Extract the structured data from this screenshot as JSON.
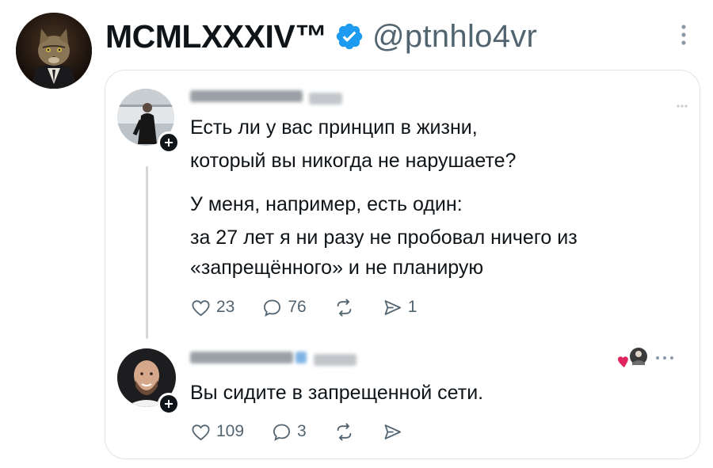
{
  "post": {
    "author_name": "MCMLXXXIV™",
    "handle": "@ptnhlo4vr"
  },
  "quoted_thread": {
    "first_post": {
      "line1": "Есть ли у вас принцип в жизни,",
      "line2": "который вы никогда не нарушаете?",
      "line3": "У меня, например, есть один:",
      "line4": "за 27 лет я ни разу не пробовал ничего из",
      "line5": "«запрещённого» и не планирую",
      "likes": "23",
      "replies": "76",
      "shares": "1"
    },
    "reply_post": {
      "text": "Вы сидите в запрещенной сети.",
      "likes": "109",
      "replies": "3"
    }
  },
  "icons": {
    "verified": "verified-badge-icon",
    "menu": "more-vertical-icon",
    "like": "heart-outline-icon",
    "reply": "comment-bubble-icon",
    "repost": "repost-arrows-icon",
    "share": "send-icon",
    "author_liked": "heart-avatar-icon",
    "more": "more-horizontal-icon"
  },
  "colors": {
    "verified": "#1d9bf0",
    "text": "#0f1419",
    "secondary": "#536471",
    "heart": "#e0245e"
  }
}
